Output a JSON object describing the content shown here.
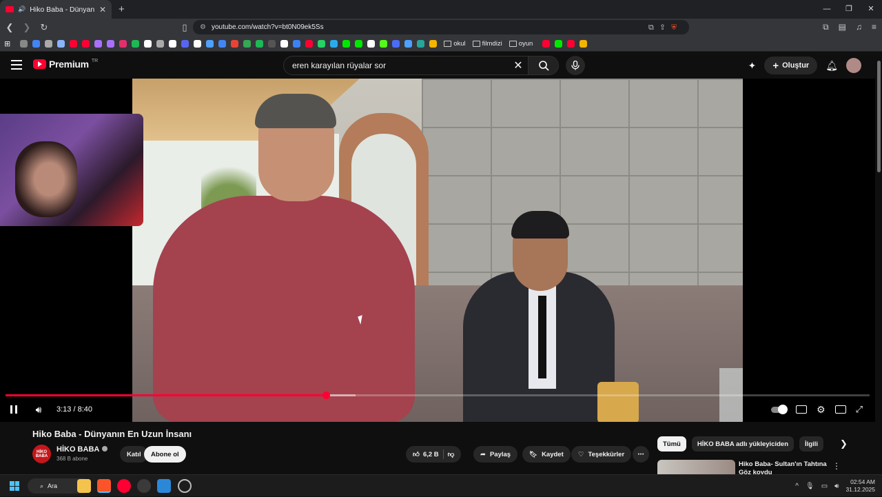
{
  "browser": {
    "tab_title": "Hiko Baba - Dünyanın En Uzun",
    "url": "youtube.com/watch?v=bt0N09ek5Ss"
  },
  "bookmarks": {
    "folders": [
      "okul",
      "filmdizi",
      "oyun"
    ],
    "icon_colors": [
      "#888888",
      "#4285f4",
      "#aaaaaa",
      "#8ab4f8",
      "#ff0033",
      "#ff0033",
      "#a970ff",
      "#a970ff",
      "#e1306c",
      "#1db954",
      "#ffffff",
      "#aaaaaa",
      "#ffffff",
      "#5865f2",
      "#ffffff",
      "#4ea1ff",
      "#4285f4",
      "#ea4335",
      "#34a853",
      "#1db954",
      "#555555",
      "#ffffff",
      "#3b82f6",
      "#ff0033",
      "#25d366",
      "#2aabee",
      "#00e701",
      "#00e701",
      "#ffffff",
      "#53fc18",
      "#4a6cf7",
      "#4ea1ff",
      "#26a69a",
      "#f4b400",
      "#ff0033",
      "#00e701",
      "#ff0033",
      "#f4b400"
    ]
  },
  "youtube": {
    "logo_text": "Premium",
    "logo_region": "TR",
    "search_query": "eren karayılan rüyalar sor",
    "create_label": "Oluştur"
  },
  "player": {
    "current_time": "3:13",
    "duration": "8:40",
    "time_display": "3:13 / 8:40",
    "progress_fraction": 0.371,
    "buffered_fraction": 0.405
  },
  "video": {
    "title": "Hiko Baba - Dünyanın En Uzun İnsanı",
    "channel_name": "HİKO BABA",
    "channel_avatar_text": "HİKO BABA",
    "subscribers": "368 B abone",
    "join_label": "Katıl",
    "subscribe_label": "Abone ol",
    "likes": "6,2 B",
    "share_label": "Paylaş",
    "save_label": "Kaydet",
    "thanks_label": "Teşekkürler"
  },
  "sidebar": {
    "chips": [
      "Tümü",
      "HİKO BABA adlı yükleyiciden",
      "İlgili"
    ],
    "rec_title": "Hiko Baba- Sultan'ın Tahtına Göz koydu"
  },
  "taskbar": {
    "search_label": "Ara",
    "time": "02:54 AM",
    "date": "31.12.2025"
  }
}
